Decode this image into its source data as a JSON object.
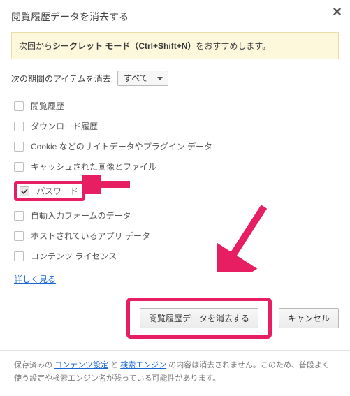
{
  "title": "閲覧履歴データを消去する",
  "hint_prefix": "次回から",
  "hint_bold": "シークレット モード（Ctrl+Shift+N）",
  "hint_suffix": "をおすすめします。",
  "time_label": "次の期間のアイテムを消去:",
  "time_selected": "すべて",
  "options": [
    {
      "label": "閲覧履歴",
      "checked": false
    },
    {
      "label": "ダウンロード履歴",
      "checked": false
    },
    {
      "label": "Cookie などのサイトデータやプラグイン データ",
      "checked": false
    },
    {
      "label": "キャッシュされた画像とファイル",
      "checked": false
    },
    {
      "label": "パスワード",
      "checked": true,
      "highlight": true
    },
    {
      "label": "自動入力フォームのデータ",
      "checked": false
    },
    {
      "label": "ホストされているアプリ データ",
      "checked": false
    },
    {
      "label": "コンテンツ ライセンス",
      "checked": false
    }
  ],
  "learn_more": "詳しく見る",
  "primary_button": "閲覧履歴データを消去する",
  "cancel_button": "キャンセル",
  "footnote_prefix": "保存済みの ",
  "footnote_link1": "コンテンツ設定",
  "footnote_mid": " と ",
  "footnote_link2": "検索エンジン",
  "footnote_suffix": " の内容は消去されません。このため、普段よく使う設定や検索エンジン名が残っている可能性があります。",
  "colors": {
    "accent": "#e81e63",
    "link": "#1967d2"
  }
}
